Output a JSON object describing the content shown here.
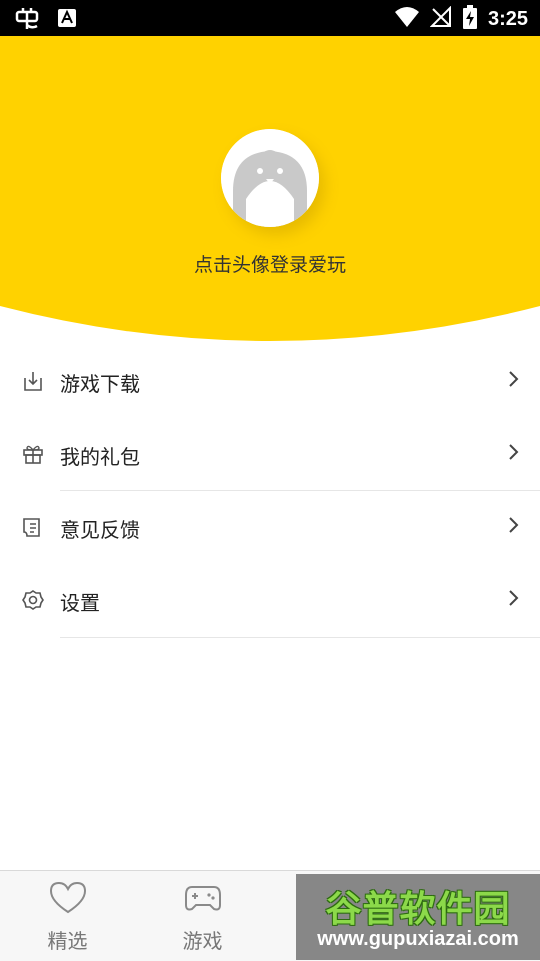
{
  "status_bar": {
    "time": "3:25",
    "icons": [
      "app-notification-icon",
      "a-notification-icon",
      "wifi-icon",
      "no-signal-icon",
      "battery-charging-icon"
    ]
  },
  "header": {
    "background_color": "#FFD200",
    "login_prompt": "点击头像登录爱玩"
  },
  "menu": {
    "items": [
      {
        "label": "游戏下载",
        "icon": "download-icon"
      },
      {
        "label": "我的礼包",
        "icon": "gift-icon"
      },
      {
        "label": "意见反馈",
        "icon": "feedback-icon"
      },
      {
        "label": "设置",
        "icon": "settings-icon"
      }
    ]
  },
  "tabbar": {
    "tabs": [
      {
        "label": "精选",
        "icon": "heart-icon"
      },
      {
        "label": "游戏",
        "icon": "gamepad-icon"
      }
    ]
  },
  "watermark": {
    "title": "谷普软件园",
    "url": "www.gupuxiazai.com"
  }
}
